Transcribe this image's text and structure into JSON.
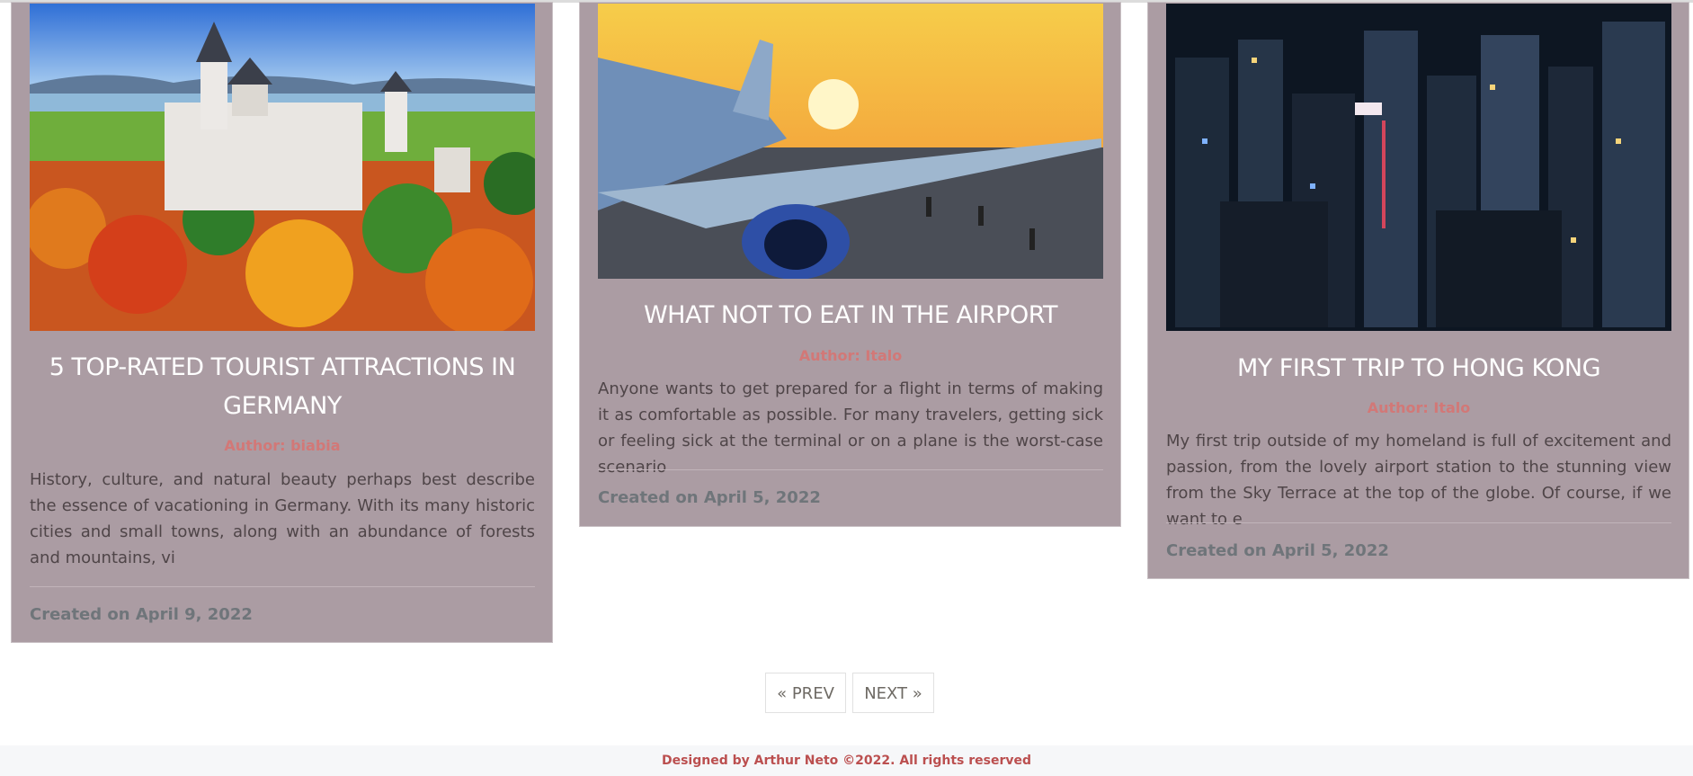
{
  "posts": [
    {
      "title": "5 TOP-RATED TOURIST ATTRACTIONS IN GERMANY",
      "author": "Author: biabia",
      "excerpt": "History, culture, and natural beauty perhaps best describe the essence of vacationing in Germany. With its many historic cities and small towns, along with an abundance of forests and mountains, vi",
      "created": "Created on April 9, 2022",
      "image_alt": "castle-photo"
    },
    {
      "title": "WHAT NOT TO EAT IN THE AIRPORT",
      "author": "Author: Italo",
      "excerpt": "Anyone wants to get prepared for a flight in terms of making it as comfortable as possible. For many travelers, getting sick or feeling sick at the terminal or on a plane is the worst-case scenario",
      "created": "Created on April 5, 2022",
      "image_alt": "airplane-photo"
    },
    {
      "title": "MY FIRST TRIP TO HONG KONG",
      "author": "Author: Italo",
      "excerpt": "My first trip outside of my homeland is full of excitement and passion, from the lovely airport station to the stunning view from the Sky Terrace at the top of the globe. Of course, if we want to e",
      "created": "Created on April 5, 2022",
      "image_alt": "city-night-photo"
    }
  ],
  "pagination": {
    "prev": "« PREV",
    "next": "NEXT »"
  },
  "footer": {
    "text": "Designed by Arthur Neto ©2022. All rights reserved"
  },
  "colors": {
    "card_bg": "#ab9ca3",
    "author": "#d27877",
    "footer_text": "#bb4f4f"
  }
}
